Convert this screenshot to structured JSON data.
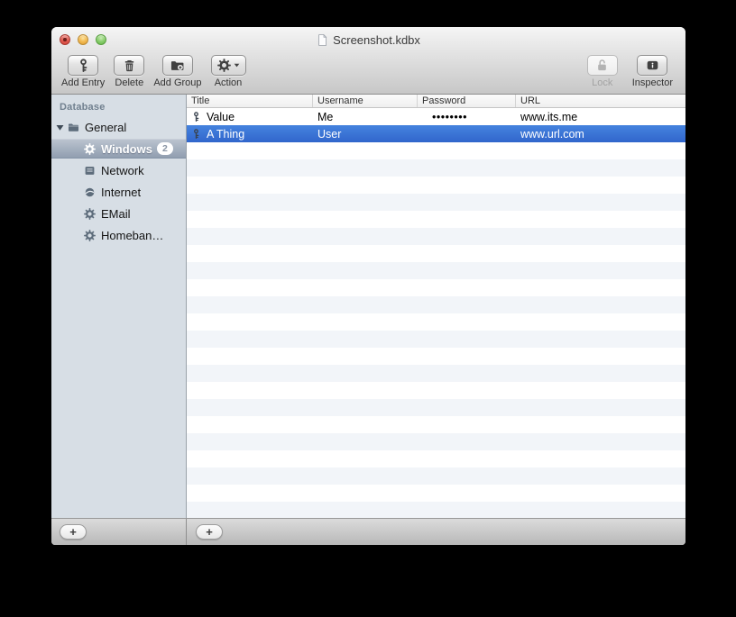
{
  "window": {
    "title": "Screenshot.kdbx"
  },
  "toolbar": {
    "add_entry": {
      "label": "Add Entry",
      "icon": "key"
    },
    "delete": {
      "label": "Delete",
      "icon": "trash"
    },
    "add_group": {
      "label": "Add Group",
      "icon": "folder-plus"
    },
    "action": {
      "label": "Action",
      "icon": "gear-dropdown"
    },
    "lock": {
      "label": "Lock",
      "icon": "lock-open",
      "disabled": true
    },
    "inspector": {
      "label": "Inspector",
      "icon": "info"
    }
  },
  "sidebar": {
    "header": "Database",
    "items": [
      {
        "label": "General",
        "icon": "folder",
        "level": 1,
        "expanded": true
      },
      {
        "label": "Windows",
        "icon": "gear",
        "level": 2,
        "badge": "2",
        "selected": true
      },
      {
        "label": "Network",
        "icon": "network",
        "level": 2
      },
      {
        "label": "Internet",
        "icon": "globe",
        "level": 2
      },
      {
        "label": "EMail",
        "icon": "gear",
        "level": 2
      },
      {
        "label": "Homeban…",
        "icon": "gear",
        "level": 2
      }
    ],
    "add_button_label": "+"
  },
  "table": {
    "columns": [
      "Title",
      "Username",
      "Password",
      "URL"
    ],
    "entries": [
      {
        "icon": "key",
        "title": "Value",
        "username": "Me",
        "password_masked": "••••••••",
        "url": "www.its.me",
        "selected": false
      },
      {
        "icon": "key",
        "title": "A Thing",
        "username": "User",
        "password_masked": "",
        "url": "www.url.com",
        "selected": true
      }
    ],
    "add_button_label": "+"
  },
  "colors": {
    "table_selection_blue": "#3a74d7",
    "sidebar_selection_top": "#bac3cf",
    "sidebar_selection_bottom": "#919eb0",
    "row_stripe": "#f2f5f9",
    "sidebar_bg": "#d7dee5"
  }
}
